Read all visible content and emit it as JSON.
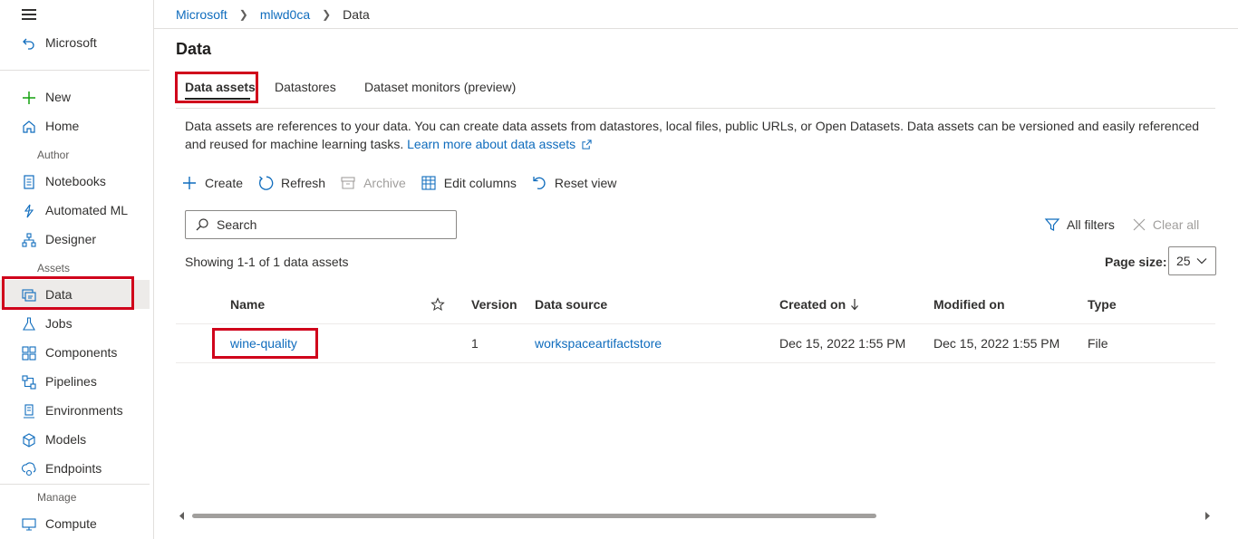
{
  "sidebar": {
    "back_label": "Microsoft",
    "items_top": [
      {
        "label": "New",
        "icon": "plus-icon"
      },
      {
        "label": "Home",
        "icon": "home-icon"
      }
    ],
    "section_author": "Author",
    "items_author": [
      {
        "label": "Notebooks",
        "icon": "notebook-icon"
      },
      {
        "label": "Automated ML",
        "icon": "automated-ml-icon"
      },
      {
        "label": "Designer",
        "icon": "designer-icon"
      }
    ],
    "section_assets": "Assets",
    "items_assets": [
      {
        "label": "Data",
        "icon": "data-icon"
      },
      {
        "label": "Jobs",
        "icon": "flask-icon"
      },
      {
        "label": "Components",
        "icon": "components-icon"
      },
      {
        "label": "Pipelines",
        "icon": "pipelines-icon"
      },
      {
        "label": "Environments",
        "icon": "environments-icon"
      },
      {
        "label": "Models",
        "icon": "cube-icon"
      },
      {
        "label": "Endpoints",
        "icon": "endpoints-icon"
      }
    ],
    "section_manage": "Manage",
    "items_manage": [
      {
        "label": "Compute",
        "icon": "monitor-icon"
      }
    ]
  },
  "breadcrumb": [
    "Microsoft",
    "mlwd0ca",
    "Data"
  ],
  "page_title": "Data",
  "tabs": [
    {
      "label": "Data assets",
      "active": true
    },
    {
      "label": "Datastores",
      "active": false
    },
    {
      "label": "Dataset monitors (preview)",
      "active": false
    }
  ],
  "description": {
    "text": "Data assets are references to your data. You can create data assets from datastores, local files, public URLs, or Open Datasets. Data assets can be versioned and easily referenced and reused for machine learning tasks.",
    "link": "Learn more about data assets"
  },
  "toolbar": {
    "create": "Create",
    "refresh": "Refresh",
    "archive": "Archive",
    "edit_columns": "Edit columns",
    "reset_view": "Reset view"
  },
  "search": {
    "placeholder": "Search"
  },
  "filters": {
    "all_filters": "All filters",
    "clear_all": "Clear all"
  },
  "showing": "Showing 1-1 of 1 data assets",
  "page_size": {
    "label": "Page size:",
    "value": "25"
  },
  "table": {
    "columns": [
      "Name",
      "Version",
      "Data source",
      "Created on",
      "Modified on",
      "Type"
    ],
    "rows": [
      {
        "name": "wine-quality",
        "version": "1",
        "data_source": "workspaceartifactstore",
        "created_on": "Dec 15, 2022 1:55 PM",
        "modified_on": "Dec 15, 2022 1:55 PM",
        "type": "File"
      }
    ]
  },
  "colors": {
    "accent": "#0f6cbd",
    "highlight": "#d0021b",
    "new_plus": "#13a10e"
  }
}
